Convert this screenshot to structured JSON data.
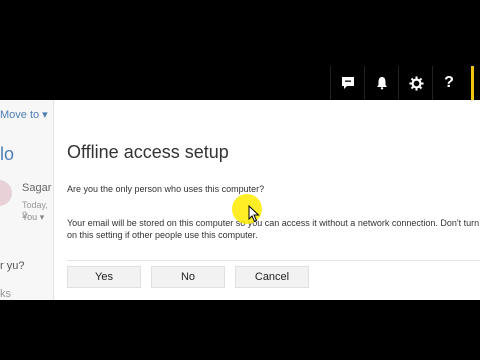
{
  "topbar": {
    "icons": [
      "chat-icon",
      "bell-icon",
      "gear-icon",
      "help-icon"
    ],
    "help_label": "?",
    "accent_color": "#f2c40f"
  },
  "background": {
    "move_to": "Move to ▾",
    "hello": "lo",
    "sender": "Sagar",
    "today": "Today, 2",
    "you": "You ▾",
    "ry": "r yu?",
    "ks": "ks"
  },
  "dialog": {
    "title": "Offline access setup",
    "question": "Are you the only person who uses this computer?",
    "description": "Your email will be stored on this computer so you can access it without a network connection. Don't turn on this setting if other people use this computer.",
    "buttons": {
      "yes": "Yes",
      "no": "No",
      "cancel": "Cancel"
    }
  }
}
